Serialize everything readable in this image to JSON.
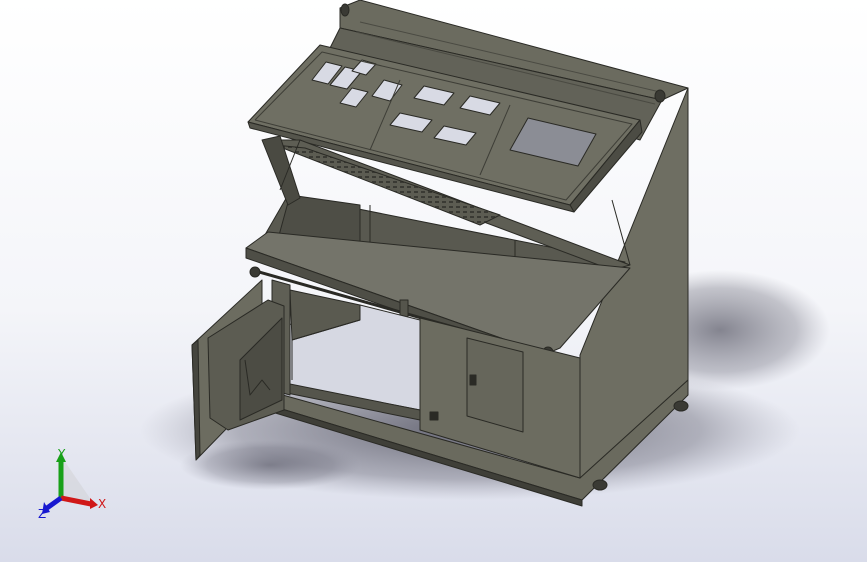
{
  "viewport": {
    "background_top": "#ffffff",
    "background_bottom": "#d9dcea"
  },
  "model": {
    "body_color": "#6e6e62",
    "panel_color": "#5f5f55",
    "dark_color": "#3a3a34",
    "edge_color": "#2a2a25",
    "highlight_color": "#8b8b7e",
    "shadow_color": "#50505e"
  },
  "triad": {
    "x_label": "X",
    "y_label": "Y",
    "z_label": "Z",
    "x_color": "#d01818",
    "y_color": "#18a018",
    "z_color": "#1818d0"
  }
}
